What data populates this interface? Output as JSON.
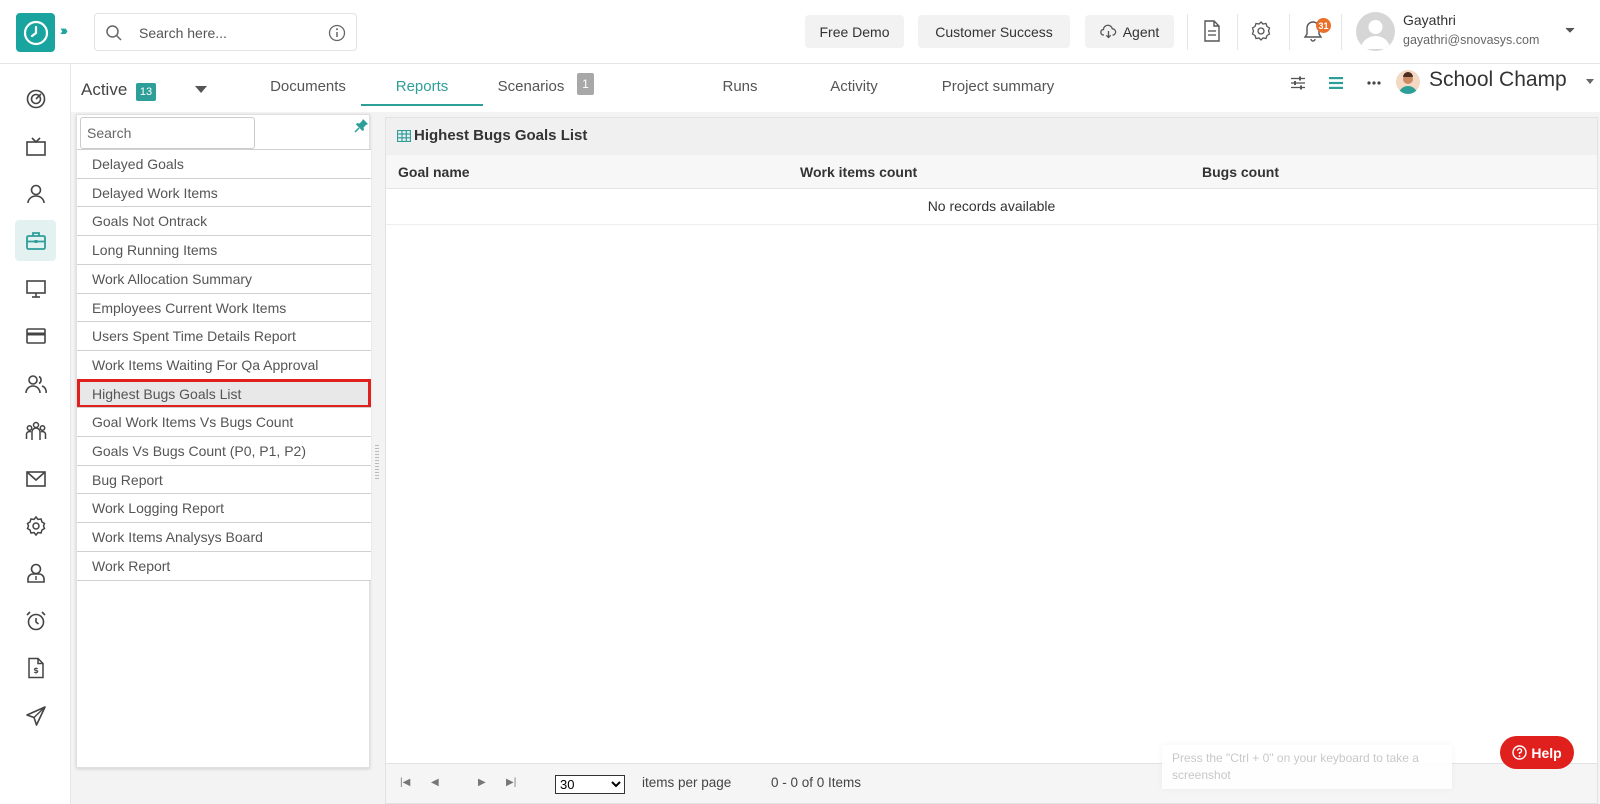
{
  "header": {
    "search_placeholder": "Search here...",
    "buttons": {
      "free_demo": "Free Demo",
      "customer_success": "Customer Success",
      "agent": "Agent"
    },
    "notifications_count": "31",
    "user": {
      "name": "Gayathri",
      "email": "gayathri@snovasys.com"
    }
  },
  "rail": {
    "icons": [
      "dashboard-icon",
      "tv-icon",
      "user-icon",
      "briefcase-icon",
      "monitor-icon",
      "card-icon",
      "users-icon",
      "team-icon",
      "mail-icon",
      "settings-icon",
      "profile-icon",
      "alarm-icon",
      "invoice-icon",
      "send-icon"
    ],
    "active_index": 3
  },
  "subnav": {
    "active_label": "Active",
    "active_count": "13",
    "tabs": [
      "Documents",
      "Reports",
      "Scenarios",
      "Runs",
      "Activity",
      "Project summary"
    ],
    "selected_tab": "Reports",
    "scenarios_count": "1",
    "project_name": "School Champ"
  },
  "report_list": {
    "search_placeholder": "Search",
    "items": [
      "Delayed Goals",
      "Delayed Work Items",
      "Goals Not Ontrack",
      "Long Running Items",
      "Work Allocation Summary",
      "Employees Current Work Items",
      "Users Spent Time Details Report",
      "Work Items Waiting For Qa Approval",
      "Highest Bugs Goals List",
      "Goal Work Items Vs Bugs Count",
      "Goals Vs Bugs Count (P0, P1, P2)",
      "Bug Report",
      "Work Logging Report",
      "Work Items Analysys Board",
      "Work Report"
    ],
    "selected_index": 8
  },
  "report": {
    "title": "Highest Bugs Goals List",
    "columns": [
      "Goal name",
      "Work items count",
      "Bugs count"
    ],
    "empty_text": "No records available",
    "pager": {
      "page_size": "30",
      "page_size_options": [
        "30"
      ],
      "items_per_page_label": "items per page",
      "range_text": "0 - 0 of 0 Items"
    }
  },
  "toast": "Press the \"Ctrl + 0\" on your keyboard to take a screenshot",
  "help_label": "Help",
  "colors": {
    "accent": "#2e9e99",
    "logo": "#1aa4a0",
    "highlight": "#e0201c",
    "notification": "#e8702a"
  }
}
